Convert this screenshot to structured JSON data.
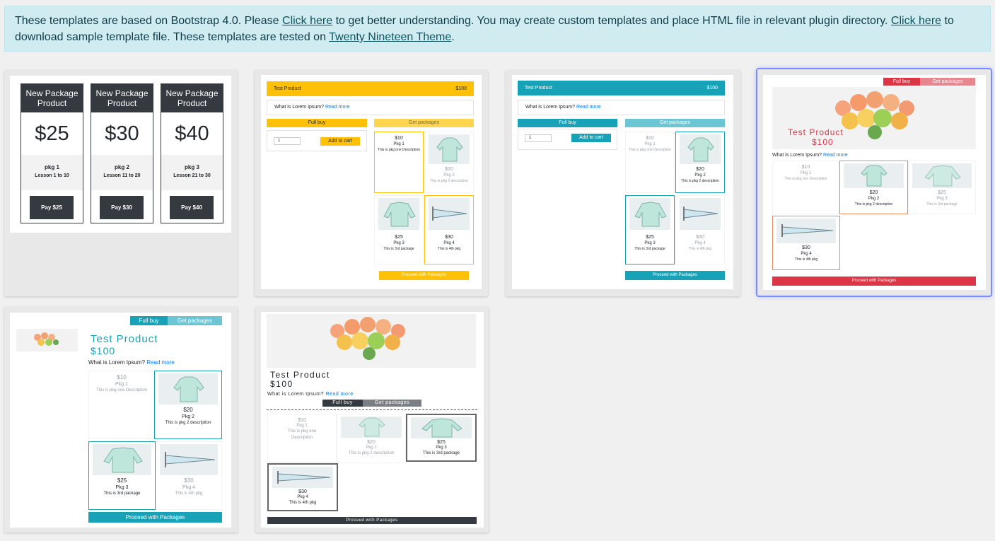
{
  "notice": {
    "p1": "These templates are based on Bootstrap 4.0. Please ",
    "link1": "Click here",
    "p2": " to get better understanding. You may create custom templates and place HTML file in relevant plugin directory. ",
    "link2": "Click here",
    "p3": " to download sample template file. These templates are tested on ",
    "link3": "Twenty Nineteen Theme",
    "p4": "."
  },
  "t1": {
    "cols": [
      {
        "title": "New Package Product",
        "price": "$25",
        "pkg": "pkg 1",
        "lesson": "Lesson 1 to 10",
        "btn": "Pay $25"
      },
      {
        "title": "New Package Product",
        "price": "$30",
        "pkg": "pkg 2",
        "lesson": "Lesson 11 to 20",
        "btn": "Pay $30"
      },
      {
        "title": "New Package Product",
        "price": "$40",
        "pkg": "pkg 3",
        "lesson": "Lesson 21 to 30",
        "btn": "Pay $40"
      }
    ]
  },
  "product": {
    "name": "Test Product",
    "price": "$100",
    "question": "What is Lorem Ipsum?",
    "read_more": "Read more",
    "full_buy": "Full buy",
    "get_packages": "Get packages",
    "add_to_cart": "Add to cart",
    "qty": "1",
    "proceed": "Proceed with Packages"
  },
  "packages": [
    {
      "price": "$10",
      "name": "Pkg 1",
      "desc": "This is pkg one Description"
    },
    {
      "price": "$20",
      "name": "Pkg 2",
      "desc": "This is pkg 2 description"
    },
    {
      "price": "$25",
      "name": "Pkg 3",
      "desc": "This is 3rd package"
    },
    {
      "price": "$30",
      "name": "Pkg 4",
      "desc": "This is 4th pkg"
    }
  ],
  "colors": {
    "yellow": "#ffc107",
    "teal": "#17a2b8",
    "red": "#dc3545",
    "dark": "#343a40",
    "notice_bg": "#d1ecf1"
  }
}
